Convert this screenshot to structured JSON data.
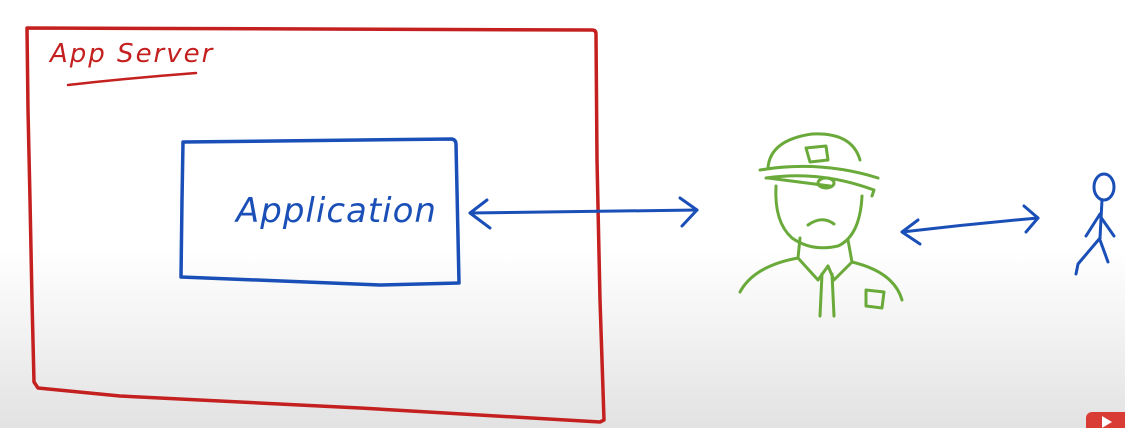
{
  "diagram": {
    "server_label": "App Server",
    "application_label": "Application",
    "colors": {
      "server": "#c42020",
      "application": "#1a4fb8",
      "guard": "#6aaa3a",
      "arrows": "#1a4fb8",
      "user": "#1a4fb8"
    },
    "icons": [
      "security-guard-icon",
      "person-icon",
      "play-icon"
    ]
  }
}
